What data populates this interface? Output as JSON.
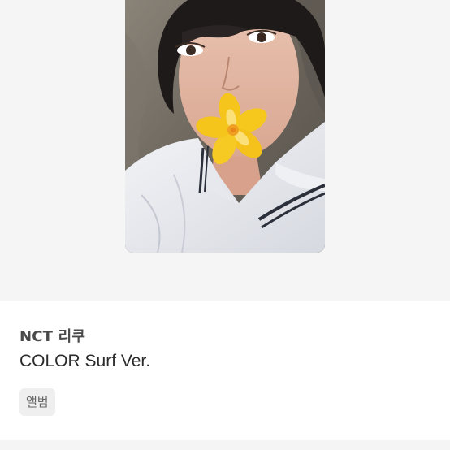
{
  "listing": {
    "artist_label": "NCT 리쿠",
    "title": "COLOR Surf Ver.",
    "tag": "앨범"
  },
  "image": {
    "description_icon": "photocard-image"
  },
  "colors": {
    "media_bg": "#f5f5f5",
    "tag_bg": "#efefef",
    "flower": "#f5c51c"
  }
}
